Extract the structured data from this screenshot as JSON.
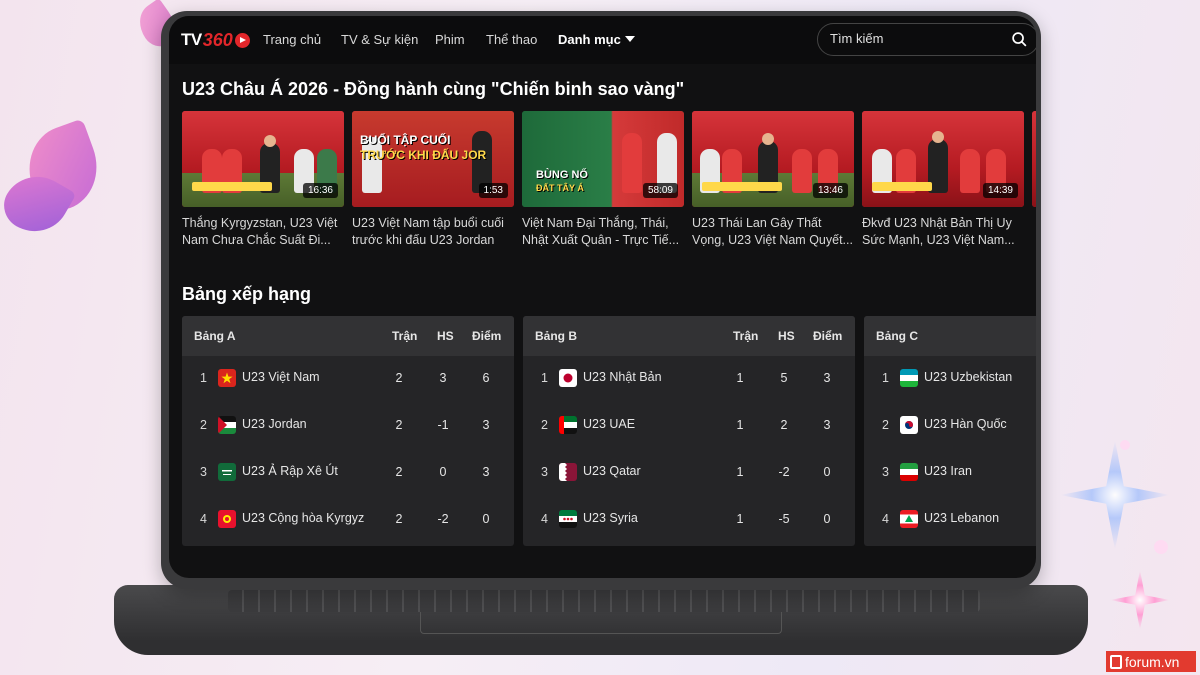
{
  "nav": {
    "logo": "TV360",
    "items": [
      "Trang chủ",
      "TV & Sự kiện",
      "Phim",
      "Thể thao",
      "Danh mục"
    ],
    "search_placeholder": "Tìm kiếm"
  },
  "featured": {
    "title": "U23 Châu Á 2026 - Đồng hành cùng \"Chiến binh sao vàng\"",
    "videos": [
      {
        "duration": "16:36",
        "title": "Thắng Kyrgyzstan, U23 Việt Nam Chưa Chắc Suất Đi..."
      },
      {
        "duration": "1:53",
        "title": "U23 Việt Nam tập buổi cuối trước khi đấu U23 Jordan",
        "banner_1": "BUỔI TẬP CUỐI",
        "banner_2": "TRƯỚC KHI ĐẤU JOR"
      },
      {
        "duration": "58:09",
        "title": "Việt Nam Đại Thắng, Thái, Nhật Xuất Quân - Trực Tiế...",
        "banner_1": "BÙNG NỔ",
        "banner_2": "ĐẤT TÂY Á"
      },
      {
        "duration": "13:46",
        "title": "U23 Thái Lan Gây Thất Vọng, U23 Việt Nam Quyết..."
      },
      {
        "duration": "14:39",
        "title": "Đkvđ U23 Nhật Bản Thị Uy Sức Mạnh, U23 Việt Nam..."
      }
    ]
  },
  "standings": {
    "title": "Bảng xếp hạng",
    "columns": {
      "played": "Trận",
      "gd": "HS",
      "points": "Điểm"
    },
    "groups": [
      {
        "name": "Bảng A",
        "rows": [
          {
            "rank": "1",
            "team": "U23 Việt Nam",
            "flag": "vietnam-flag-icon",
            "played": "2",
            "gd": "3",
            "points": "6"
          },
          {
            "rank": "2",
            "team": "U23 Jordan",
            "flag": "jordan-flag-icon",
            "played": "2",
            "gd": "-1",
            "points": "3"
          },
          {
            "rank": "3",
            "team": "U23 Ả Rập Xê Út",
            "flag": "saudi-arabia-flag-icon",
            "played": "2",
            "gd": "0",
            "points": "3"
          },
          {
            "rank": "4",
            "team": "U23 Cộng hòa Kyrgyz",
            "flag": "kyrgyzstan-flag-icon",
            "played": "2",
            "gd": "-2",
            "points": "0"
          }
        ]
      },
      {
        "name": "Bảng B",
        "rows": [
          {
            "rank": "1",
            "team": "U23 Nhật Bản",
            "flag": "japan-flag-icon",
            "played": "1",
            "gd": "5",
            "points": "3"
          },
          {
            "rank": "2",
            "team": "U23 UAE",
            "flag": "uae-flag-icon",
            "played": "1",
            "gd": "2",
            "points": "3"
          },
          {
            "rank": "3",
            "team": "U23 Qatar",
            "flag": "qatar-flag-icon",
            "played": "1",
            "gd": "-2",
            "points": "0"
          },
          {
            "rank": "4",
            "team": "U23 Syria",
            "flag": "syria-flag-icon",
            "played": "1",
            "gd": "-5",
            "points": "0"
          }
        ]
      },
      {
        "name": "Bảng C",
        "rows": [
          {
            "rank": "1",
            "team": "U23 Uzbekistan",
            "flag": "uzbekistan-flag-icon"
          },
          {
            "rank": "2",
            "team": "U23 Hàn Quốc",
            "flag": "south-korea-flag-icon"
          },
          {
            "rank": "3",
            "team": "U23 Iran",
            "flag": "iran-flag-icon"
          },
          {
            "rank": "4",
            "team": "U23 Lebanon",
            "flag": "lebanon-flag-icon"
          }
        ]
      }
    ]
  },
  "watermark": "forum.vn",
  "colors": {
    "brand_red": "#e2262a",
    "card_bg": "#252527",
    "header_bg": "#323234",
    "page_bg": "#111112"
  }
}
